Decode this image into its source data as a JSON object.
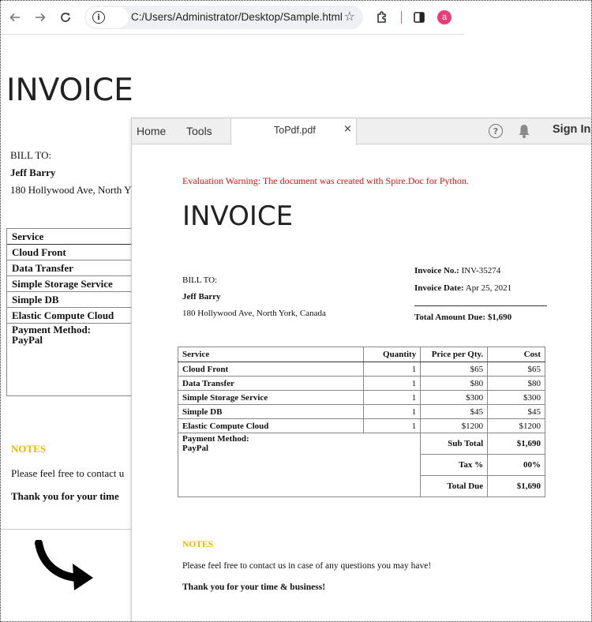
{
  "browser": {
    "address": "C:/Users/Administrator/Desktop/Sample.html",
    "avatar_letter": "a",
    "icons": [
      "back-arrow-icon",
      "forward-arrow-icon",
      "reload-icon",
      "info-icon",
      "star-icon",
      "extensions-icon",
      "side-panel-icon"
    ]
  },
  "html_doc": {
    "title": "INVOICE",
    "bill_to_label": "BILL TO:",
    "customer": "Jeff Barry",
    "address": "180 Hollywood Ave, North Y",
    "table_header": "Service",
    "services": [
      "Cloud Front",
      "Data Transfer",
      "Simple Storage Service",
      "Simple DB",
      "Elastic Compute Cloud"
    ],
    "payment_label": "Payment Method:",
    "payment_value": "PayPal",
    "notes_heading": "NOTES",
    "note_line": "Please feel free to contact u",
    "thanks_line": "Thank you for your time"
  },
  "pdf_viewer": {
    "tabs": {
      "home": "Home",
      "tools": "Tools"
    },
    "document_tab": "ToPdf.pdf",
    "close_glyph": "×",
    "help_glyph": "?",
    "sign_in": "Sign In"
  },
  "pdf_doc": {
    "warning": "Evaluation Warning: The document was created with Spire.Doc for Python.",
    "title": "INVOICE",
    "bill_to_label": "BILL TO:",
    "customer": "Jeff Barry",
    "address": "180 Hollywood Ave, North York, Canada",
    "invoice_no_label": "Invoice No.:",
    "invoice_no": "INV-35274",
    "invoice_date_label": "Invoice Date:",
    "invoice_date": "Apr 25, 2021",
    "total_due_label": "Total Amount Due:",
    "total_due": "$1,690",
    "columns": [
      "Service",
      "Quantity",
      "Price per Qty.",
      "Cost"
    ],
    "rows": [
      {
        "service": "Cloud Front",
        "qty": "1",
        "price": "$65",
        "cost": "$65"
      },
      {
        "service": "Data Transfer",
        "qty": "1",
        "price": "$80",
        "cost": "$80"
      },
      {
        "service": "Simple Storage Service",
        "qty": "1",
        "price": "$300",
        "cost": "$300"
      },
      {
        "service": "Simple DB",
        "qty": "1",
        "price": "$45",
        "cost": "$45"
      },
      {
        "service": "Elastic Compute Cloud",
        "qty": "1",
        "price": "$1200",
        "cost": "$1200"
      }
    ],
    "payment_label": "Payment Method:",
    "payment_value": "PayPal",
    "subtotal_label": "Sub Total",
    "subtotal": "$1,690",
    "tax_label": "Tax %",
    "tax": "00%",
    "total_label": "Total Due",
    "total": "$1,690",
    "notes_heading": "NOTES",
    "note_line": "Please feel free to contact us in case of any questions you may have!",
    "thanks_line": "Thank you for your time & business!"
  }
}
